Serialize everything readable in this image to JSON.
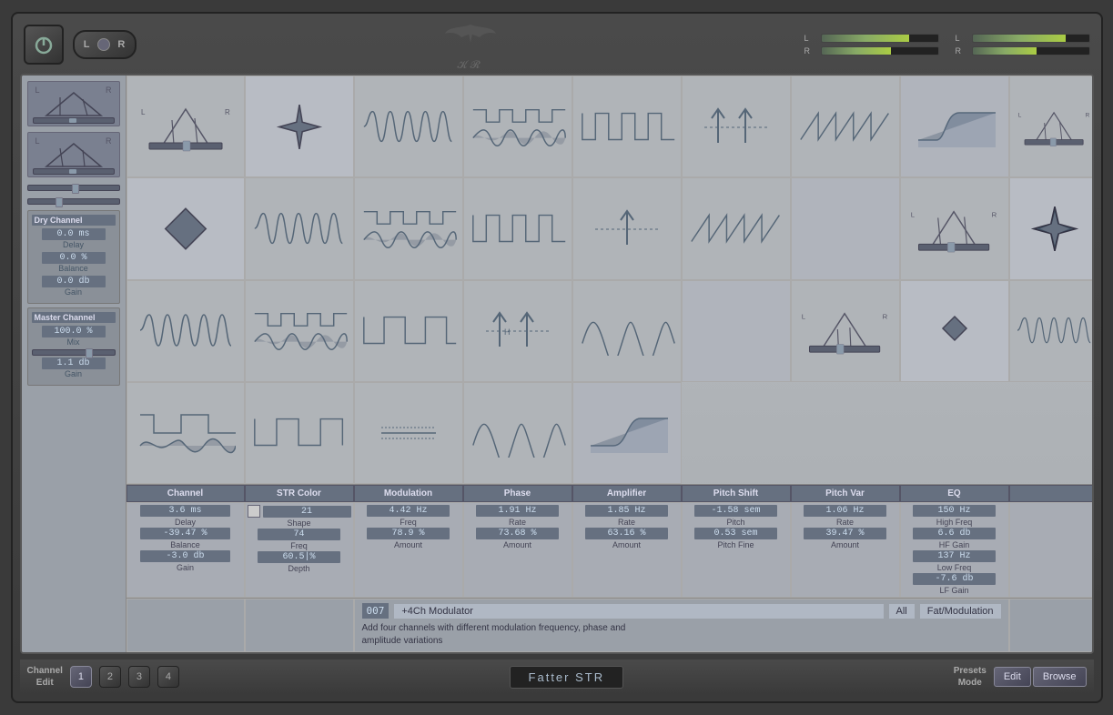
{
  "topBar": {
    "powerBtn": "⏻",
    "lrSwitch": {
      "l": "L",
      "r": "R"
    },
    "logo": "🦅",
    "logoSubtext": "KR",
    "meters": [
      {
        "label": "L",
        "value": 75,
        "groupLabel": "left"
      },
      {
        "label": "R",
        "value": 60,
        "groupLabel": "left"
      },
      {
        "label": "L",
        "value": 80,
        "groupLabel": "right"
      },
      {
        "label": "R",
        "value": 55,
        "groupLabel": "right"
      }
    ]
  },
  "leftPanel": {
    "dryChannel": {
      "header": "Dry Channel",
      "delay": {
        "value": "0.0 ms",
        "label": "Delay"
      },
      "balance": {
        "value": "0.0 %",
        "label": "Balance"
      },
      "gain": {
        "value": "0.0 db",
        "label": "Gain"
      }
    },
    "masterChannel": {
      "header": "Master Channel",
      "mix": {
        "value": "100.0 %",
        "label": "Mix"
      },
      "gain": {
        "value": "1.1 db",
        "label": "Gain"
      }
    }
  },
  "colHeaders": [
    "Channel",
    "STR Color",
    "Modulation",
    "Phase",
    "Amplifier",
    "Pitch Shift",
    "Pitch Var",
    "EQ"
  ],
  "channels": [
    {
      "channel": {
        "delay": "3.6 ms",
        "balance": "-39.47 %",
        "gain": "-3.0 db"
      },
      "strColor": {
        "shape": "21",
        "freq": "74",
        "depth": "60.5|%"
      },
      "modulation": {
        "freq": "4.42 Hz",
        "amount": "78.9 %"
      },
      "phase": {
        "rate": "1.91 Hz",
        "amount": "73.68 %"
      },
      "amplifier": {
        "rate": "1.85 Hz",
        "amount": "63.16 %"
      },
      "pitchShift": {
        "pitch": "-1.58 sem",
        "pitchFine": "0.53 sem"
      },
      "pitchVar": {
        "rate": "1.06 Hz",
        "amount": "39.47 %"
      },
      "eq": {
        "highFreq": "150 Hz",
        "hfGain": "6.6 db",
        "lowFreq": "137 Hz",
        "lfGain": "-7.6 db"
      }
    }
  ],
  "paramRows": [
    {
      "channelDelay": "3.6 ms",
      "channelDelayLabel": "Delay",
      "channelBalance": "-39.47 %",
      "channelBalanceLabel": "Balance",
      "channelGain": "-3.0 db",
      "channelGainLabel": "Gain",
      "strShape": "21",
      "strShapeLabel": "Shape",
      "strFreq": "74",
      "strFreqLabel": "Freq",
      "strDepth": "60.5|%",
      "strDepthLabel": "Depth",
      "modFreq": "4.42 Hz",
      "modFreqLabel": "Freq",
      "modAmount": "78.9 %",
      "modAmountLabel": "Amount",
      "phaseRate": "1.91 Hz",
      "phaseRateLabel": "Rate",
      "phaseAmount": "73.68 %",
      "phaseAmountLabel": "Amount",
      "ampRate": "1.85 Hz",
      "ampRateLabel": "Rate",
      "ampAmount": "63.16 %",
      "ampAmountLabel": "Amount",
      "pitchPitch": "-1.58 sem",
      "pitchPitchLabel": "Pitch",
      "pitchFine": "0.53 sem",
      "pitchFineLabel": "Pitch Fine",
      "pitchVarRate": "1.06 Hz",
      "pitchVarRateLabel": "Rate",
      "pitchVarAmount": "39.47 %",
      "pitchVarAmountLabel": "Amount",
      "eqHighFreq": "150 Hz",
      "eqHighFreqLabel": "High Freq",
      "eqHfGain": "6.6 db",
      "eqHfGainLabel": "HF Gain",
      "eqLowFreq": "137 Hz",
      "eqLowFreqLabel": "Low Freq",
      "eqLfGain": "-7.6 db",
      "eqLfGainLabel": "LF Gain"
    }
  ],
  "preset": {
    "number": "007",
    "name": "+4Ch Modulator",
    "category": "All",
    "preset2": "Fat/Modulation",
    "description": "Add four channels with different modulation frequency, phase and\namplitude variations"
  },
  "bottomBar": {
    "channelEdit": "Channel\nEdit",
    "channels": [
      "1",
      "2",
      "3",
      "4"
    ],
    "activeChannel": "1",
    "pluginName": "Fatter STR",
    "presetsMode": "Presets\nMode",
    "editBtn": "Edit",
    "browseBtn": "Browse"
  }
}
